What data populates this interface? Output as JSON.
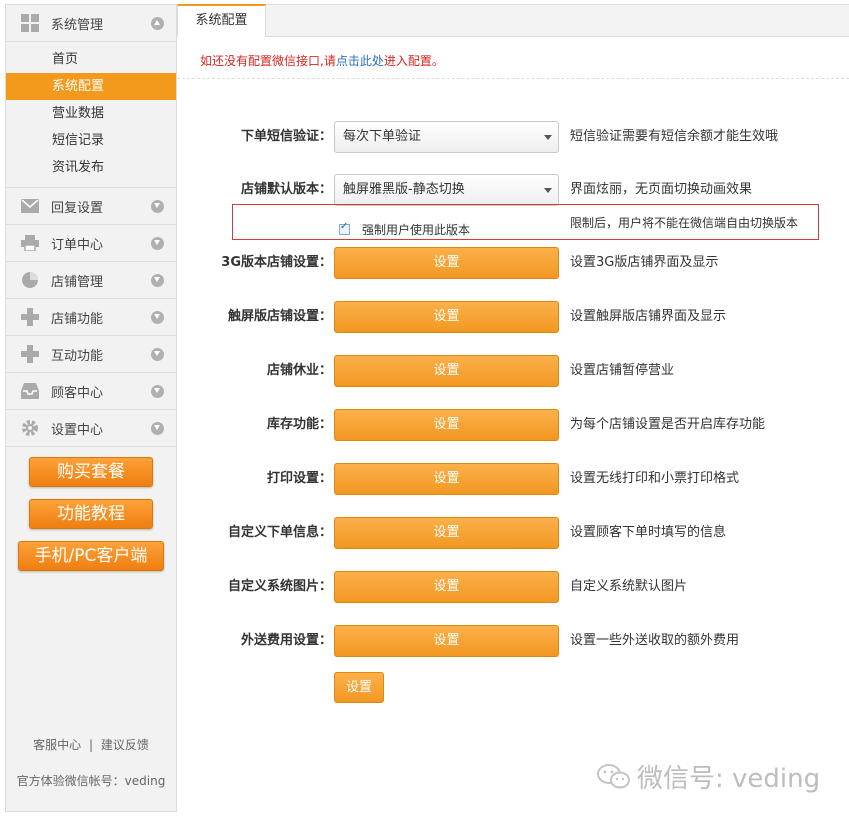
{
  "sidebar": {
    "groups": [
      {
        "label": "系统管理",
        "icon": "grid-icon"
      },
      {
        "label": "回复设置",
        "icon": "envelope-icon"
      },
      {
        "label": "订单中心",
        "icon": "printer-icon"
      },
      {
        "label": "店铺管理",
        "icon": "pie-chart-icon"
      },
      {
        "label": "店铺功能",
        "icon": "plus-icon"
      },
      {
        "label": "互动功能",
        "icon": "plus-icon"
      },
      {
        "label": "顾客中心",
        "icon": "inbox-icon"
      },
      {
        "label": "设置中心",
        "icon": "gear-icon"
      }
    ],
    "sub_items": [
      "首页",
      "系统配置",
      "营业数据",
      "短信记录",
      "资讯发布"
    ],
    "promo": [
      "购买套餐",
      "功能教程",
      "手机/PC客户端"
    ],
    "footer": {
      "service": "客服中心",
      "separator": "|",
      "feedback": "建议反馈",
      "account": "官方体验微信帐号：veding"
    }
  },
  "main": {
    "tab": "系统配置",
    "notice": {
      "pre": "如还没有配置微信接口,请",
      "link": "点击此处",
      "post": "进入配置。"
    },
    "sms": {
      "label": "下单短信验证：",
      "value": "每次下单验证",
      "desc": "短信验证需要有短信余额才能生效哦"
    },
    "version": {
      "label": "店铺默认版本：",
      "value": "触屏雅黑版-静态切换",
      "desc": "界面炫丽，无页面切换动画效果"
    },
    "force": {
      "label": "强制用户使用此版本",
      "checked": true,
      "desc": "限制后，用户将不能在微信端自由切换版本"
    },
    "settings": [
      {
        "label": "3G版本店铺设置：",
        "button": "设置",
        "desc": "设置3G版店铺界面及显示"
      },
      {
        "label": "触屏版店铺设置：",
        "button": "设置",
        "desc": "设置触屏版店铺界面及显示"
      },
      {
        "label": "店铺休业：",
        "button": "设置",
        "desc": "设置店铺暂停营业"
      },
      {
        "label": "库存功能：",
        "button": "设置",
        "desc": "为每个店铺设置是否开启库存功能"
      },
      {
        "label": "打印设置：",
        "button": "设置",
        "desc": "设置无线打印和小票打印格式"
      },
      {
        "label": "自定义下单信息：",
        "button": "设置",
        "desc": "设置顾客下单时填写的信息"
      },
      {
        "label": "自定义系统图片：",
        "button": "设置",
        "desc": "自定义系统默认图片"
      },
      {
        "label": "外送费用设置：",
        "button": "设置",
        "desc": "设置一些外送收取的额外费用"
      }
    ],
    "save": "设置"
  },
  "watermark": "微信号: veding"
}
